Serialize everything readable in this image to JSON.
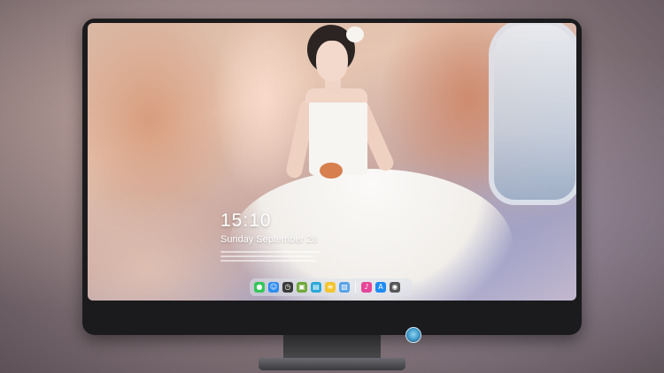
{
  "lock_screen": {
    "time": "15:10",
    "date": "Sunday September 28"
  },
  "dock": {
    "apps": [
      {
        "name": "messages",
        "glyph": "●",
        "color": "#34c759"
      },
      {
        "name": "finder",
        "glyph": "☺",
        "color": "#2f8cf0"
      },
      {
        "name": "clock",
        "glyph": "◷",
        "color": "#3a3a3a"
      },
      {
        "name": "preview",
        "glyph": "▣",
        "color": "#6fa83a"
      },
      {
        "name": "claquette",
        "glyph": "▤",
        "color": "#2aa8d8"
      },
      {
        "name": "notes",
        "glyph": "≡",
        "color": "#f2c531"
      },
      {
        "name": "photos",
        "glyph": "▧",
        "color": "#58a2e8"
      },
      {
        "name": "music",
        "glyph": "♪",
        "color": "#e64598"
      },
      {
        "name": "app-store",
        "glyph": "A",
        "color": "#1e8cf5"
      },
      {
        "name": "camera",
        "glyph": "◉",
        "color": "#555558"
      }
    ],
    "separator_after": 7
  },
  "colors": {
    "monitor_bezel": "#1b1b1d",
    "dock_background": "rgba(220,225,235,0.55)"
  }
}
